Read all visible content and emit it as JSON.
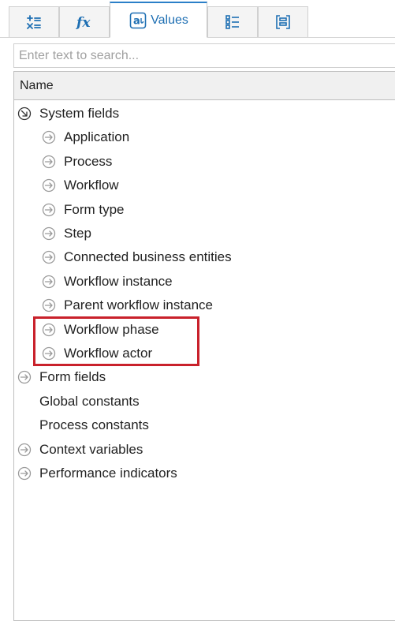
{
  "tabs": [
    {
      "id": "operators",
      "icon": "operators-icon",
      "label": ""
    },
    {
      "id": "functions",
      "icon": "function-icon",
      "label": ""
    },
    {
      "id": "values",
      "icon": "at-sign-icon",
      "label": "Values",
      "active": true
    },
    {
      "id": "list",
      "icon": "list-icon",
      "label": ""
    },
    {
      "id": "brackets",
      "icon": "bracket-box-icon",
      "label": ""
    }
  ],
  "search": {
    "placeholder": "Enter text to search..."
  },
  "tree": {
    "column_header": "Name",
    "items": [
      {
        "label": "System fields",
        "level": 0,
        "icon": "expanded-arrow-icon"
      },
      {
        "label": "Application",
        "level": 1,
        "icon": "collapsed-arrow-icon"
      },
      {
        "label": "Process",
        "level": 1,
        "icon": "collapsed-arrow-icon"
      },
      {
        "label": "Workflow",
        "level": 1,
        "icon": "collapsed-arrow-icon"
      },
      {
        "label": "Form type",
        "level": 1,
        "icon": "collapsed-arrow-icon"
      },
      {
        "label": "Step",
        "level": 1,
        "icon": "collapsed-arrow-icon"
      },
      {
        "label": "Connected business entities",
        "level": 1,
        "icon": "collapsed-arrow-icon"
      },
      {
        "label": "Workflow instance",
        "level": 1,
        "icon": "collapsed-arrow-icon"
      },
      {
        "label": "Parent workflow instance",
        "level": 1,
        "icon": "collapsed-arrow-icon"
      },
      {
        "label": "Workflow phase",
        "level": 1,
        "icon": "collapsed-arrow-icon"
      },
      {
        "label": "Workflow actor",
        "level": 1,
        "icon": "collapsed-arrow-icon"
      },
      {
        "label": "Form fields",
        "level": 0,
        "icon": "collapsed-arrow-icon"
      },
      {
        "label": "Global constants",
        "level": 0,
        "icon": "none"
      },
      {
        "label": "Process constants",
        "level": 0,
        "icon": "none"
      },
      {
        "label": "Context variables",
        "level": 0,
        "icon": "collapsed-arrow-icon"
      },
      {
        "label": "Performance indicators",
        "level": 0,
        "icon": "collapsed-arrow-icon"
      }
    ]
  },
  "colors": {
    "accent": "#1e6fb3",
    "highlight": "#c9212b"
  }
}
